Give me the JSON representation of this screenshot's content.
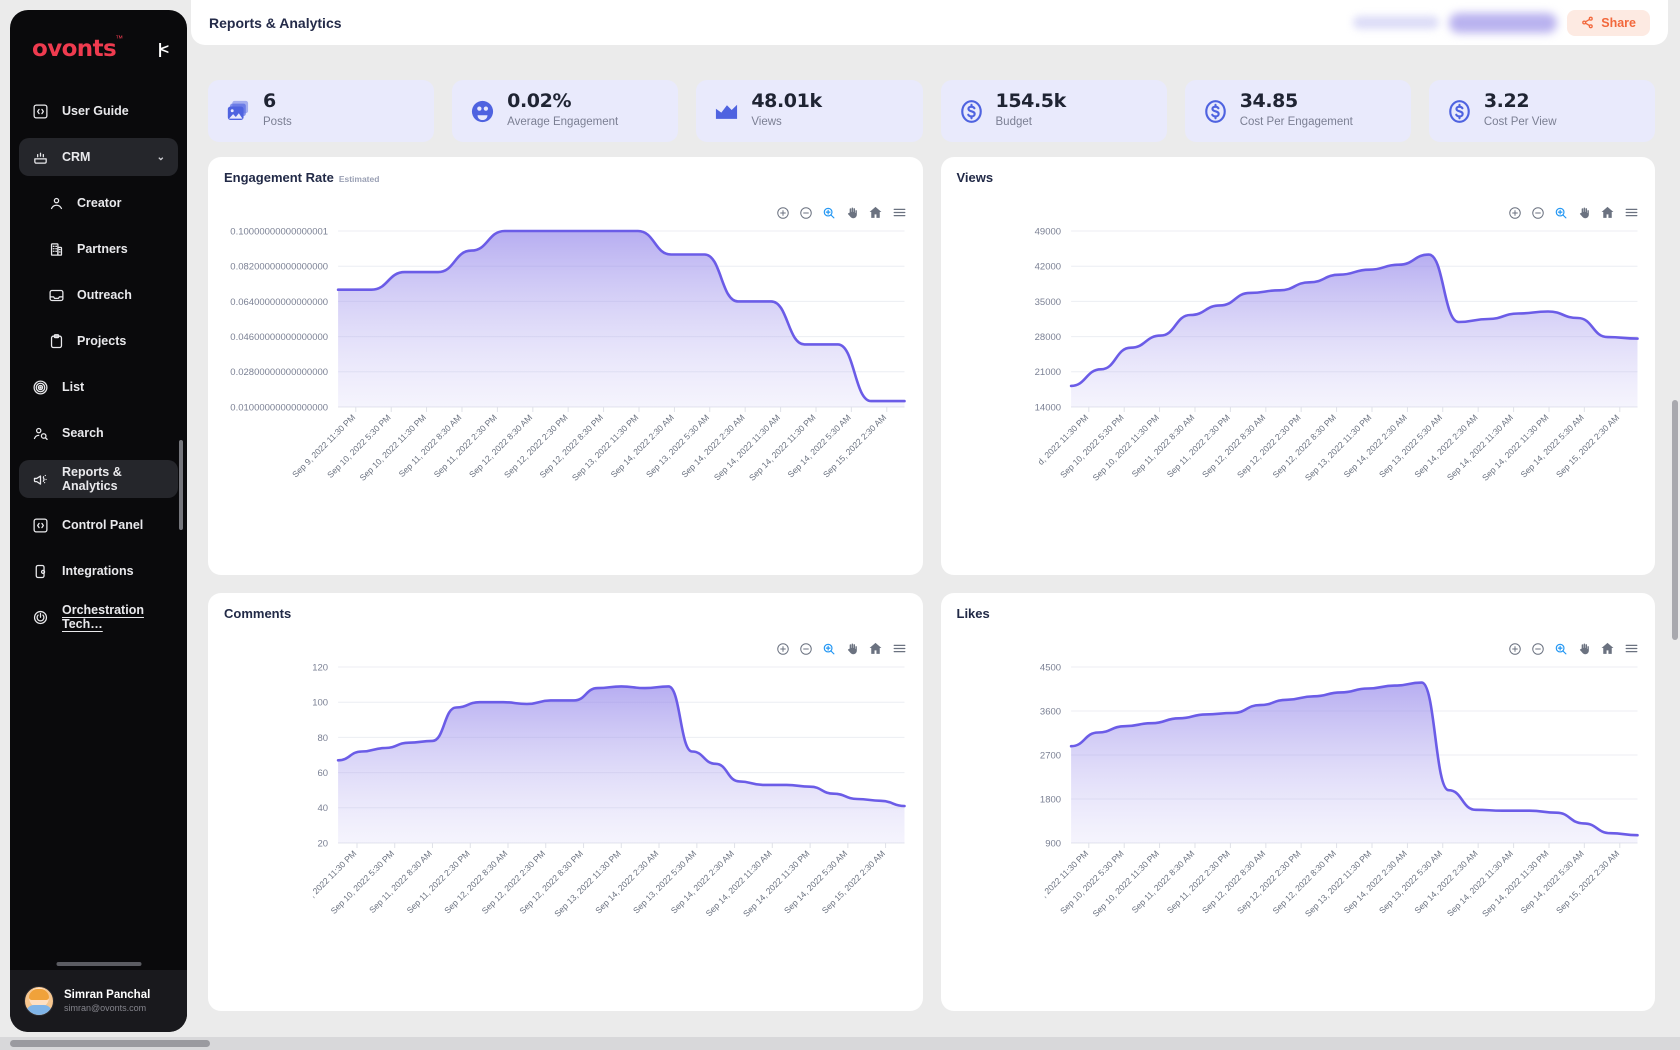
{
  "brand": {
    "name": "ovonts",
    "tm": "™",
    "color": "#ef3b4f"
  },
  "sidebar": {
    "collapse_icon": "collapse-left-icon",
    "items": [
      {
        "label": "User Guide",
        "icon": "code-brackets-icon",
        "level": 0,
        "active": false
      },
      {
        "label": "CRM",
        "icon": "crm-icon",
        "level": 0,
        "active": true,
        "chevron": "⌄"
      },
      {
        "label": "Creator",
        "icon": "person-icon",
        "level": 1,
        "active": false
      },
      {
        "label": "Partners",
        "icon": "building-icon",
        "level": 1,
        "active": false
      },
      {
        "label": "Outreach",
        "icon": "inbox-icon",
        "level": 1,
        "active": false
      },
      {
        "label": "Projects",
        "icon": "clipboard-icon",
        "level": 1,
        "active": false
      },
      {
        "label": "List",
        "icon": "target-rings-icon",
        "level": 0,
        "active": false
      },
      {
        "label": "Search",
        "icon": "person-search-icon",
        "level": 0,
        "active": false
      },
      {
        "label": "Reports & Analytics",
        "icon": "megaphone-icon",
        "level": 0,
        "active": true
      },
      {
        "label": "Control Panel",
        "icon": "code-brackets-icon",
        "level": 0,
        "active": false
      },
      {
        "label": "Integrations",
        "icon": "phone-gear-icon",
        "level": 0,
        "active": false
      },
      {
        "label": "Orchestration Tech…",
        "icon": "power-dial-icon",
        "level": 0,
        "active": false,
        "underline": true
      }
    ],
    "user": {
      "name": "Simran Panchal",
      "email": "simran@ovonts.com",
      "avatar": "user-avatar"
    }
  },
  "header": {
    "title": "Reports & Analytics",
    "share_label": "Share",
    "share_icon": "share-icon"
  },
  "stats": [
    {
      "value": "6",
      "label": "Posts",
      "icon": "images-icon"
    },
    {
      "value": "0.02%",
      "label": "Average Engagement",
      "icon": "engagement-face-icon"
    },
    {
      "value": "48.01k",
      "label": "Views",
      "icon": "mountain-chart-icon"
    },
    {
      "value": "154.5k",
      "label": "Budget",
      "icon": "dollar-circle-icon"
    },
    {
      "value": "34.85",
      "label": "Cost Per Engagement",
      "icon": "dollar-circle-icon"
    },
    {
      "value": "3.22",
      "label": "Cost Per View",
      "icon": "dollar-circle-icon"
    }
  ],
  "chart_toolbar": [
    {
      "name": "zoom-in-icon",
      "label": "+"
    },
    {
      "name": "zoom-out-icon",
      "label": "−"
    },
    {
      "name": "selection-zoom-icon",
      "label": "magnifier",
      "selected": true
    },
    {
      "name": "panning-icon",
      "label": "hand"
    },
    {
      "name": "reset-zoom-icon",
      "label": "home"
    },
    {
      "name": "menu-icon",
      "label": "hamburger"
    }
  ],
  "chart_data": [
    {
      "id": "engagement-rate",
      "type": "area",
      "title": "Engagement Rate",
      "subtitle": "Estimated",
      "xlabel": "",
      "ylabel": "",
      "grid": true,
      "legend": "none",
      "ylim": [
        0.01,
        0.1
      ],
      "yticks": [
        "0.01000000000000000",
        "0.02800000000000000",
        "0.04600000000000000",
        "0.06400000000000000",
        "0.08200000000000000",
        "0.10000000000000001"
      ],
      "categories": [
        "Sep 9, 2022 11:30 PM",
        "Sep 10, 2022 5:30 PM",
        "Sep 10, 2022 11:30 PM",
        "Sep 11, 2022 8:30 AM",
        "Sep 11, 2022 2:30 PM",
        "Sep 12, 2022 8:30 AM",
        "Sep 12, 2022 2:30 PM",
        "Sep 12, 2022 8:30 PM",
        "Sep 13, 2022 11:30 PM",
        "Sep 14, 2022 2:30 AM",
        "Sep 13, 2022 5:30 AM",
        "Sep 14, 2022 2:30 AM",
        "Sep 14, 2022 11:30 AM",
        "Sep 14, 2022 11:30 PM",
        "Sep 14, 2022 5:30 AM",
        "Sep 15, 2022 2:30 AM"
      ],
      "values": [
        0.07,
        0.07,
        0.079,
        0.079,
        0.09,
        0.1,
        0.1,
        0.1,
        0.1,
        0.1,
        0.088,
        0.088,
        0.064,
        0.064,
        0.042,
        0.042,
        0.013,
        0.013
      ]
    },
    {
      "id": "views",
      "type": "area",
      "title": "Views",
      "subtitle": "",
      "xlabel": "",
      "ylabel": "",
      "grid": true,
      "legend": "none",
      "ylim": [
        14000,
        49000
      ],
      "yticks": [
        "14000",
        "21000",
        "28000",
        "35000",
        "42000",
        "49000"
      ],
      "categories": [
        "d, 2022 11:30 PM",
        "Sep 10, 2022 5:30 PM",
        "Sep 10, 2022 11:30 PM",
        "Sep 11, 2022 8:30 AM",
        "Sep 11, 2022 2:30 PM",
        "Sep 12, 2022 8:30 AM",
        "Sep 12, 2022 2:30 PM",
        "Sep 12, 2022 8:30 PM",
        "Sep 13, 2022 11:30 PM",
        "Sep 14, 2022 2:30 AM",
        "Sep 13, 2022 5:30 AM",
        "Sep 14, 2022 2:30 AM",
        "Sep 14, 2022 11:30 AM",
        "Sep 14, 2022 11:30 PM",
        "Sep 14, 2022 5:30 AM",
        "Sep 15, 2022 2:30 AM"
      ],
      "values": [
        18200,
        21500,
        25800,
        28200,
        32300,
        34200,
        36700,
        37200,
        38800,
        40300,
        41300,
        42300,
        44300,
        30900,
        31500,
        32600,
        33000,
        31700,
        27900,
        27600
      ]
    },
    {
      "id": "comments",
      "type": "area",
      "title": "Comments",
      "subtitle": "",
      "xlabel": "",
      "ylabel": "",
      "grid": true,
      "legend": "none",
      "ylim": [
        20,
        120
      ],
      "yticks": [
        "20",
        "40",
        "60",
        "80",
        "100",
        "120"
      ],
      "categories": [
        ", 2022 11:30 PM",
        "Sep 10, 2022 5:30 PM",
        "Sep 11, 2022 8:30 AM",
        "Sep 11, 2022 2:30 PM",
        "Sep 12, 2022 8:30 AM",
        "Sep 12, 2022 2:30 PM",
        "Sep 12, 2022 8:30 PM",
        "Sep 13, 2022 11:30 PM",
        "Sep 14, 2022 2:30 AM",
        "Sep 13, 2022 5:30 AM",
        "Sep 14, 2022 2:30 AM",
        "Sep 14, 2022 11:30 AM",
        "Sep 14, 2022 11:30 PM",
        "Sep 14, 2022 5:30 AM",
        "Sep 15, 2022 2:30 AM"
      ],
      "values": [
        67,
        72,
        74,
        77,
        78,
        97,
        100,
        100,
        99,
        101,
        101,
        108,
        109,
        108,
        109,
        72,
        65,
        55,
        53,
        53,
        52,
        48,
        45,
        44,
        41
      ]
    },
    {
      "id": "likes",
      "type": "area",
      "title": "Likes",
      "subtitle": "",
      "xlabel": "",
      "ylabel": "",
      "grid": true,
      "legend": "none",
      "ylim": [
        900,
        4500
      ],
      "yticks": [
        "900",
        "1800",
        "2700",
        "3600",
        "4500"
      ],
      "categories": [
        ", 2022 11:30 PM",
        "Sep 10, 2022 5:30 PM",
        "Sep 10, 2022 11:30 PM",
        "Sep 11, 2022 8:30 AM",
        "Sep 11, 2022 2:30 PM",
        "Sep 12, 2022 8:30 AM",
        "Sep 12, 2022 2:30 PM",
        "Sep 12, 2022 8:30 PM",
        "Sep 13, 2022 11:30 PM",
        "Sep 14, 2022 2:30 AM",
        "Sep 13, 2022 5:30 AM",
        "Sep 14, 2022 2:30 AM",
        "Sep 14, 2022 11:30 AM",
        "Sep 14, 2022 11:30 PM",
        "Sep 14, 2022 5:30 AM",
        "Sep 15, 2022 2:30 AM"
      ],
      "values": [
        2880,
        3160,
        3290,
        3350,
        3450,
        3530,
        3560,
        3720,
        3830,
        3900,
        3980,
        4060,
        4120,
        4180,
        1980,
        1580,
        1560,
        1560,
        1520,
        1300,
        1100,
        1060
      ]
    }
  ],
  "colors": {
    "accent": "#6b5ce7",
    "stat_card_bg": "#e9eafc",
    "share_bg": "#fdeae2",
    "share_fg": "#f2683c",
    "sidebar_bg": "#0a0a0c"
  }
}
